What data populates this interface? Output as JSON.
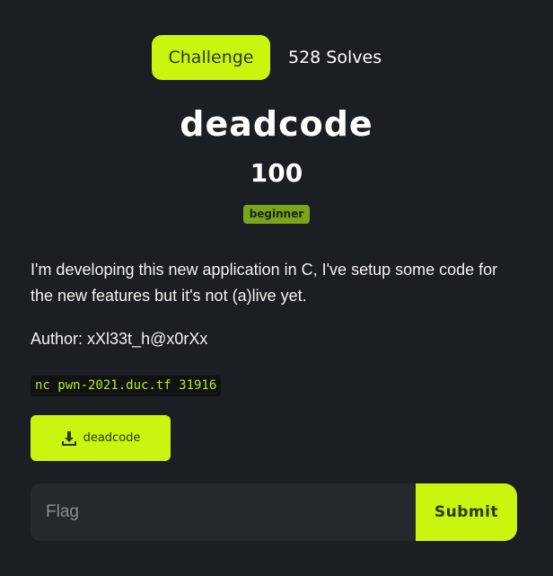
{
  "tabs": {
    "challenge_label": "Challenge",
    "solves_label": "528 Solves"
  },
  "challenge": {
    "name": "deadcode",
    "points": "100",
    "tag": "beginner",
    "description": "I'm developing this new application in C, I've setup some code for the new features but it's not (a)live yet.",
    "author": "Author: xXl33t_h@x0rXx",
    "connection": "nc pwn-2021.duc.tf 31916",
    "file_label": "deadcode"
  },
  "flag_form": {
    "placeholder": "Flag",
    "submit_label": "Submit"
  },
  "icons": {
    "download": "download-icon"
  },
  "colors": {
    "background": "#1b1e22",
    "accent": "#c9f50e",
    "tag": "#7aa51a",
    "input_bg": "#25282c",
    "code_text": "#b9ef16"
  }
}
